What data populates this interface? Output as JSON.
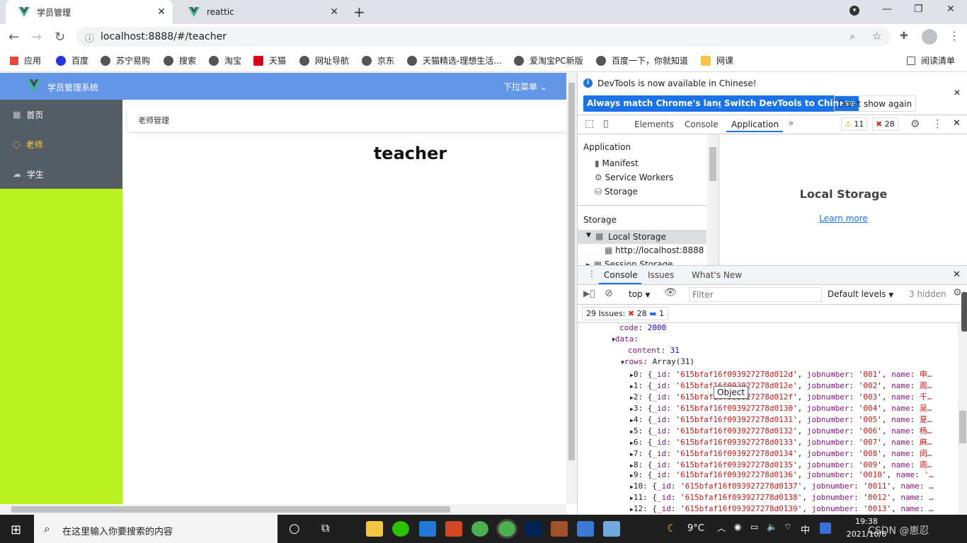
{
  "browser": {
    "tabs": [
      {
        "title": "学员管理",
        "active": true
      },
      {
        "title": "reattic",
        "active": false
      }
    ],
    "url": "localhost:8888/#/teacher",
    "bookmarks": [
      "应用",
      "百度",
      "苏宁易购",
      "搜索",
      "淘宝",
      "天猫",
      "网址导航",
      "京东",
      "天猫精选-理想生活...",
      "爱淘宝PC新版",
      "百度一下，你就知道",
      "网课"
    ],
    "reading_list": "阅读清单"
  },
  "app": {
    "brand": "学员管理系统",
    "dropdown": "下拉菜单",
    "menu": [
      {
        "label": "首页",
        "active": false
      },
      {
        "label": "老师",
        "active": true
      },
      {
        "label": "学生",
        "active": false
      }
    ],
    "breadcrumb": "老师管理",
    "page_title": "teacher"
  },
  "devtools": {
    "banner": "DevTools is now available in Chinese!",
    "btn_match": "Always match Chrome's language",
    "btn_switch": "Switch DevTools to Chinese",
    "btn_dont": "Don't show again",
    "tabs": [
      "Elements",
      "Console",
      "Application"
    ],
    "active_tab": "Application",
    "warn_count": "11",
    "error_count": "28",
    "app_section": "Application",
    "app_items": [
      "Manifest",
      "Service Workers",
      "Storage"
    ],
    "storage_section": "Storage",
    "local_storage": "Local Storage",
    "local_origin": "http://localhost:8888",
    "session_storage": "Session Storage",
    "main_title": "Local Storage",
    "learn_more": "Learn more",
    "drawer_tabs": [
      "Console",
      "Issues",
      "What's New"
    ],
    "context": "top",
    "filter_placeholder": "Filter",
    "levels": "Default levels",
    "hidden": "3 hidden",
    "issues_label": "29 Issues:",
    "issues_errors": "28",
    "issues_info": "1",
    "tooltip": "Object",
    "console": {
      "code": "2000",
      "content": "31",
      "rows_label": "Array(31)",
      "rows": [
        {
          "i": "0",
          "id": "615bfaf16f093927278d012d",
          "jn": "001",
          "name": "申…"
        },
        {
          "i": "1",
          "id": "615bfaf16f093927278d012e",
          "jn": "002",
          "name": "周…"
        },
        {
          "i": "2",
          "id": "615bfaf16f093927278d012f",
          "jn": "003",
          "name": "千…"
        },
        {
          "i": "3",
          "id": "615bfaf16f093927278d0130",
          "jn": "004",
          "name": "吴…"
        },
        {
          "i": "4",
          "id": "615bfaf16f093927278d0131",
          "jn": "005",
          "name": "夏…"
        },
        {
          "i": "5",
          "id": "615bfaf16f093927278d0132",
          "jn": "006",
          "name": "杨…"
        },
        {
          "i": "6",
          "id": "615bfaf16f093927278d0133",
          "jn": "007",
          "name": "麻…"
        },
        {
          "i": "7",
          "id": "615bfaf16f093927278d0134",
          "jn": "008",
          "name": "闵…"
        },
        {
          "i": "8",
          "id": "615bfaf16f093927278d0135",
          "jn": "009",
          "name": "周…"
        },
        {
          "i": "9",
          "id": "615bfaf16f093927278d0136",
          "jn": "0010",
          "name": "'…"
        },
        {
          "i": "10",
          "id": "615bfaf16f093927278d0137",
          "jn": "0011",
          "name": "…"
        },
        {
          "i": "11",
          "id": "615bfaf16f093927278d0138",
          "jn": "0012",
          "name": "…"
        },
        {
          "i": "12",
          "id": "615bfaf16f093927278d0139",
          "jn": "0013",
          "name": "…"
        }
      ]
    }
  },
  "taskbar": {
    "search_placeholder": "在这里输入你要搜索的内容",
    "weather": "9°C",
    "ime": "中",
    "time": "19:38",
    "date": "2021/10/6",
    "watermark": "CSDN @崽忍"
  },
  "colors": {
    "header_blue": "#6496e8",
    "sidebar_dark": "#545c64",
    "sidebar_fill": "#b8f321",
    "active_menu": "#ffd04b",
    "devtools_blue": "#1a73e8"
  }
}
